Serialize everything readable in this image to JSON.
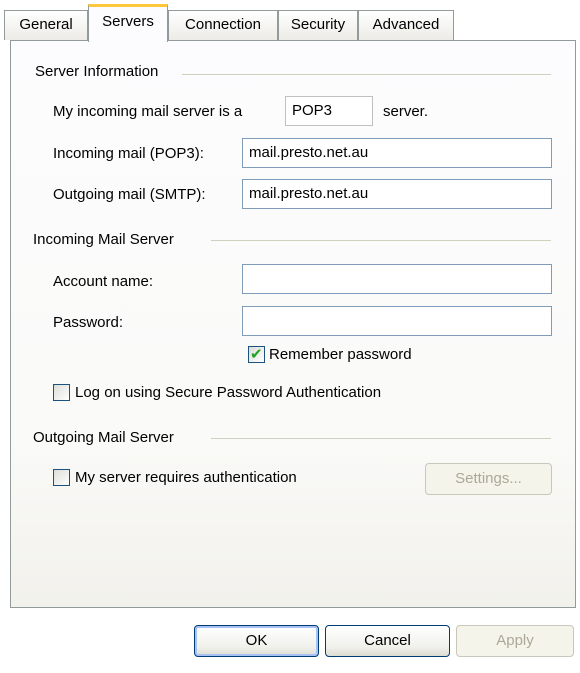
{
  "tabs": [
    {
      "label": "General"
    },
    {
      "label": "Servers"
    },
    {
      "label": "Connection"
    },
    {
      "label": "Security"
    },
    {
      "label": "Advanced"
    }
  ],
  "active_tab": "Servers",
  "server_info": {
    "title": "Server Information",
    "incoming_type_prefix": "My incoming mail server is a",
    "incoming_type_value": "POP3",
    "incoming_type_suffix": "server.",
    "incoming_label": "Incoming mail (POP3):",
    "incoming_value": "mail.presto.net.au",
    "outgoing_label": "Outgoing mail (SMTP):",
    "outgoing_value": "mail.presto.net.au"
  },
  "incoming_server": {
    "title": "Incoming Mail Server",
    "account_label": "Account name:",
    "account_value": "",
    "password_label": "Password:",
    "password_value": "",
    "remember_label": "Remember password",
    "remember_checked": true,
    "spa_label": "Log on using Secure Password Authentication",
    "spa_checked": false
  },
  "outgoing_server": {
    "title": "Outgoing Mail Server",
    "auth_label": "My server requires authentication",
    "auth_checked": false,
    "settings_label": "Settings..."
  },
  "buttons": {
    "ok": "OK",
    "cancel": "Cancel",
    "apply": "Apply"
  }
}
